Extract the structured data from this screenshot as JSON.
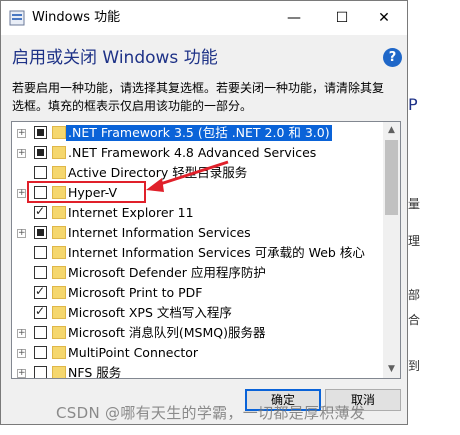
{
  "window": {
    "title": "Windows 功能",
    "heading": "启用或关闭 Windows 功能",
    "help": "?",
    "description": "若要启用一种功能，请选择其复选框。若要关闭一种功能，请清除其复选框。填充的框表示仅启用该功能的一部分。",
    "controls": {
      "minimize": "—",
      "maximize": "☐",
      "close": "✕"
    }
  },
  "features": [
    {
      "label": ".NET Framework 3.5 (包括 .NET 2.0 和 3.0)",
      "state": "partial",
      "expandable": true,
      "selected": true
    },
    {
      "label": ".NET Framework 4.8 Advanced Services",
      "state": "partial",
      "expandable": true
    },
    {
      "label": "Active Directory 轻型目录服务",
      "state": "unchecked",
      "expandable": false
    },
    {
      "label": "Hyper-V",
      "state": "unchecked",
      "expandable": true
    },
    {
      "label": "Internet Explorer 11",
      "state": "checked",
      "expandable": false
    },
    {
      "label": "Internet Information Services",
      "state": "partial",
      "expandable": true
    },
    {
      "label": "Internet Information Services 可承载的 Web 核心",
      "state": "unchecked",
      "expandable": false
    },
    {
      "label": "Microsoft Defender 应用程序防护",
      "state": "unchecked",
      "expandable": false
    },
    {
      "label": "Microsoft Print to PDF",
      "state": "checked",
      "expandable": false
    },
    {
      "label": "Microsoft XPS 文档写入程序",
      "state": "checked",
      "expandable": false
    },
    {
      "label": "Microsoft 消息队列(MSMQ)服务器",
      "state": "unchecked",
      "expandable": true
    },
    {
      "label": "MultiPoint Connector",
      "state": "unchecked",
      "expandable": true
    },
    {
      "label": "NFS 服务",
      "state": "unchecked",
      "expandable": true
    }
  ],
  "buttons": {
    "ok": "确定",
    "cancel": "取消"
  },
  "background_fragments": [
    "P",
    "量",
    "理",
    "部",
    "合",
    "到"
  ],
  "watermark": "CSDN @哪有天生的学霸，一切都是厚积薄发",
  "colors": {
    "accent": "#0a63d8",
    "annotation": "#e0202a",
    "heading": "#1e3287"
  }
}
